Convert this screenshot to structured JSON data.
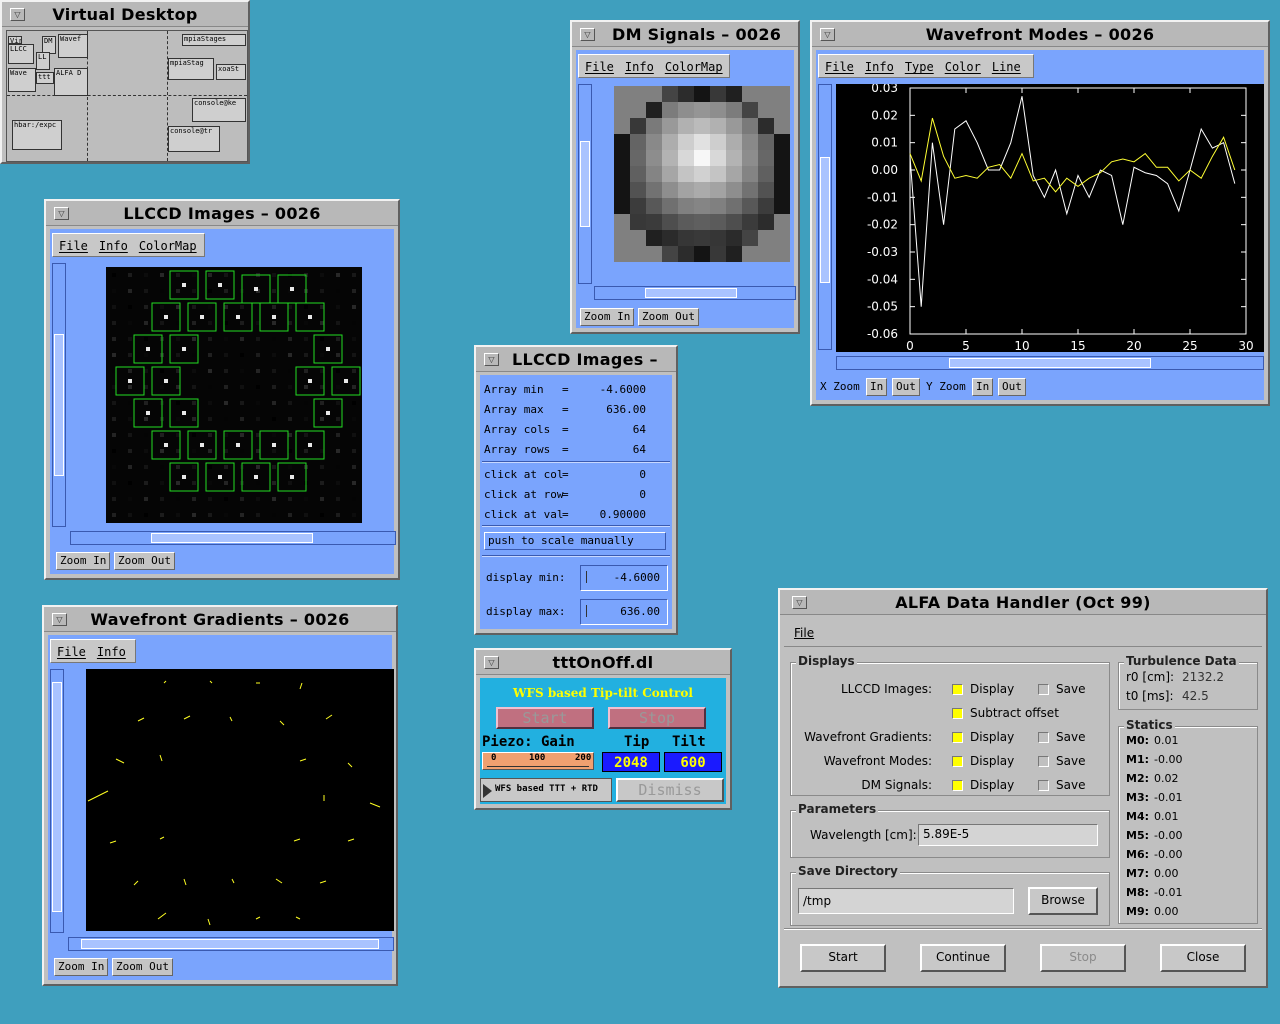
{
  "virtual_desktop": {
    "title": "Virtual Desktop",
    "thumbs": [
      "Vir",
      "LLCC",
      "DM",
      "Wavef",
      "LL",
      "ttt",
      "Wave",
      "ALFA D",
      "mpiaStages",
      "mpiaStag",
      "xoaSt",
      "console@ke",
      "hbar:/expc",
      "console@tr"
    ]
  },
  "llccd_main": {
    "title": "LLCCD Images – 0026",
    "menu": [
      "File",
      "Info",
      "ColorMap"
    ],
    "zoom_in": "Zoom In",
    "zoom_out": "Zoom Out"
  },
  "gradients": {
    "title": "Wavefront Gradients – 0026",
    "menu": [
      "File",
      "Info"
    ],
    "zoom_in": "Zoom In",
    "zoom_out": "Zoom Out"
  },
  "dm_signals": {
    "title": "DM Signals – 0026",
    "menu": [
      "File",
      "Info",
      "ColorMap"
    ],
    "zoom_in": "Zoom In",
    "zoom_out": "Zoom Out"
  },
  "modes": {
    "title": "Wavefront Modes – 0026",
    "menu": [
      "File",
      "Info",
      "Type",
      "Color",
      "Line"
    ],
    "x_zoom": "X Zoom",
    "y_zoom": "Y Zoom",
    "in": "In",
    "out": "Out"
  },
  "chart_data": {
    "type": "line",
    "ylim": [
      -0.06,
      0.03
    ],
    "xlim": [
      0,
      30
    ],
    "y_ticks": [
      "0.03",
      "0.02",
      "0.01",
      "0.00",
      "-0.01",
      "-0.02",
      "-0.03",
      "-0.04",
      "-0.05",
      "-0.06"
    ],
    "x_ticks": [
      "0",
      "5",
      "10",
      "15",
      "20",
      "25",
      "30"
    ],
    "colors": {
      "series_a": "#ffffff",
      "series_b": "#ffff33"
    },
    "series": [
      {
        "x": [
          0,
          1,
          2,
          3,
          4,
          5,
          6,
          7,
          8,
          9,
          10,
          11,
          12,
          13,
          14,
          15,
          16,
          17,
          18,
          19,
          20,
          21,
          22,
          23,
          24,
          25,
          26,
          27,
          28,
          29
        ],
        "values": [
          0.005,
          -0.05,
          0.01,
          -0.02,
          0.015,
          0.018,
          0.01,
          0.0,
          0.0,
          0.01,
          0.027,
          -0.002,
          -0.01,
          0.0,
          -0.016,
          -0.002,
          -0.01,
          0.0,
          -0.002,
          -0.02,
          0.001,
          -0.001,
          -0.002,
          -0.005,
          -0.015,
          0.0,
          0.015,
          0.008,
          0.01,
          -0.005
        ]
      },
      {
        "x": [
          0,
          1,
          2,
          3,
          4,
          5,
          6,
          7,
          8,
          9,
          10,
          11,
          12,
          13,
          14,
          15,
          16,
          17,
          18,
          19,
          20,
          21,
          22,
          23,
          24,
          25,
          26,
          27,
          28,
          29
        ],
        "values": [
          0.006,
          -0.004,
          0.019,
          0.005,
          -0.003,
          -0.002,
          -0.003,
          0.001,
          0.002,
          -0.003,
          0.006,
          -0.004,
          -0.003,
          -0.008,
          -0.003,
          -0.006,
          -0.003,
          -0.001,
          0.003,
          0.004,
          0.003,
          0.006,
          0.001,
          0.001,
          -0.004,
          0.0,
          -0.003,
          0.005,
          0.012,
          0.0
        ]
      }
    ]
  },
  "llccd_info": {
    "title": "LLCCD Images –",
    "rows": [
      {
        "label": "Array min",
        "eq": "=",
        "value": "-4.6000"
      },
      {
        "label": "Array max",
        "eq": "=",
        "value": "636.00"
      },
      {
        "label": "Array cols",
        "eq": "=",
        "value": "64"
      },
      {
        "label": "Array rows",
        "eq": "=",
        "value": "64"
      }
    ],
    "click_rows": [
      {
        "label": "click at col",
        "eq": "=",
        "value": "0"
      },
      {
        "label": "click at row",
        "eq": "=",
        "value": "0"
      },
      {
        "label": "click at val",
        "eq": "=",
        "value": "0.90000"
      }
    ],
    "scale_button": "push to scale manually",
    "display_min_label": "display min:",
    "display_min": "-4.6000",
    "display_max_label": "display max:",
    "display_max": "636.00"
  },
  "ttt": {
    "title": "tttOnOff.dl",
    "header": "WFS based Tip-tilt Control",
    "start": "Start",
    "stop": "Stop",
    "piezo_label": "Piezo: Gain",
    "tip_label": "Tip",
    "tilt_label": "Tilt",
    "gain_min": "0",
    "gain_mid": "100",
    "gain_max": "200",
    "tip_value": "2048",
    "tilt_value": "600",
    "footer_label": "WFS based TTT + RTD",
    "dismiss": "Dismiss",
    "colors": {
      "panel": "#22b0e0",
      "header_text": "#ffff00",
      "button": "#c07080",
      "value_bg": "#1a1aff",
      "value_text": "#ffff00"
    }
  },
  "alfa": {
    "title": "ALFA Data Handler (Oct 99)",
    "menu_file": "File",
    "displays_label": "Displays",
    "display_rows": [
      {
        "name": "LLCCD Images:",
        "display": "Display",
        "save": "Save",
        "display_on": true,
        "save_on": false
      },
      {
        "name": "Wavefront Gradients:",
        "display": "Display",
        "save": "Save",
        "display_on": true,
        "save_on": false
      },
      {
        "name": "Wavefront Modes:",
        "display": "Display",
        "save": "Save",
        "display_on": true,
        "save_on": false
      },
      {
        "name": "DM Signals:",
        "display": "Display",
        "save": "Save",
        "display_on": true,
        "save_on": false
      }
    ],
    "subtract_offset": "Subtract offset",
    "subtract_offset_on": true,
    "parameters_label": "Parameters",
    "wavelength_label": "Wavelength [cm]:",
    "wavelength_value": "5.89E-5",
    "save_dir_label": "Save Directory",
    "save_dir_value": "/tmp",
    "browse": "Browse",
    "turb_label": "Turbulence Data",
    "r0_label": "r0 [cm]:",
    "r0_value": "2132.2",
    "t0_label": "t0 [ms]:",
    "t0_value": "42.5",
    "statics_label": "Statics",
    "statics": [
      {
        "label": "M0:",
        "value": "0.01"
      },
      {
        "label": "M1:",
        "value": "-0.00"
      },
      {
        "label": "M2:",
        "value": "0.02"
      },
      {
        "label": "M3:",
        "value": "-0.01"
      },
      {
        "label": "M4:",
        "value": "0.01"
      },
      {
        "label": "M5:",
        "value": "-0.00"
      },
      {
        "label": "M6:",
        "value": "-0.00"
      },
      {
        "label": "M7:",
        "value": "0.00"
      },
      {
        "label": "M8:",
        "value": "-0.01"
      },
      {
        "label": "M9:",
        "value": "0.00"
      }
    ],
    "buttons": [
      "Start",
      "Continue",
      "Stop",
      "Close"
    ],
    "stop_disabled": true
  }
}
